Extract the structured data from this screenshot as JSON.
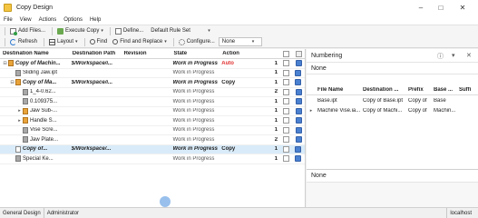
{
  "window": {
    "title": "Copy Design"
  },
  "menu": [
    "File",
    "View",
    "Actions",
    "Options",
    "Help"
  ],
  "toolbar1": {
    "add_files": "Add Files...",
    "execute_copy": "Execute Copy",
    "define": "Define...",
    "rule_set": "Default Rule Set"
  },
  "toolbar2": {
    "refresh": "Refresh",
    "layout": "Layout",
    "find": "Find",
    "find_replace": "Find and Replace",
    "configure": "Configure...",
    "config_value": "None"
  },
  "grid": {
    "headers": [
      "Destination Name",
      "Destination Path",
      "Revision",
      "State",
      "Action"
    ],
    "rows": [
      {
        "expander": "⊟",
        "icon": "asm",
        "name": "Copy of Machin...",
        "path": "$/Workspace/i...",
        "revision": "",
        "state": "Work in Progress",
        "action": "Auto",
        "count": "1",
        "bold": true,
        "italic": true
      },
      {
        "expander": "",
        "icon": "prt",
        "name": "Sliding Jaw.ipt",
        "path": "",
        "revision": "",
        "state": "Work in Progress",
        "action": "",
        "count": "1",
        "bold": false,
        "italic": false
      },
      {
        "expander": "⊟",
        "icon": "asm",
        "name": "Copy of Ma...",
        "path": "$/Workspace/i...",
        "revision": "",
        "state": "Work in Progress",
        "action": "Copy",
        "count": "1",
        "bold": true,
        "italic": true
      },
      {
        "expander": "",
        "icon": "prt",
        "name": "1_4-0.62...",
        "path": "",
        "revision": "",
        "state": "Work in Progress",
        "action": "",
        "count": "2",
        "bold": false,
        "italic": false
      },
      {
        "expander": "",
        "icon": "prt",
        "name": "0.109375...",
        "path": "",
        "revision": "",
        "state": "Work in Progress",
        "action": "",
        "count": "1",
        "bold": false,
        "italic": false
      },
      {
        "expander": "▸",
        "icon": "asm",
        "name": "Jaw Sub-...",
        "path": "",
        "revision": "",
        "state": "Work in Progress",
        "action": "",
        "count": "1",
        "bold": false,
        "italic": false
      },
      {
        "expander": "▸",
        "icon": "asm",
        "name": "Handle S...",
        "path": "",
        "revision": "",
        "state": "Work in Progress",
        "action": "",
        "count": "1",
        "bold": false,
        "italic": false
      },
      {
        "expander": "",
        "icon": "prt",
        "name": "Vise Scre...",
        "path": "",
        "revision": "",
        "state": "Work in Progress",
        "action": "",
        "count": "1",
        "bold": false,
        "italic": false
      },
      {
        "expander": "",
        "icon": "prt",
        "name": "Jaw Plate...",
        "path": "",
        "revision": "",
        "state": "Work in Progress",
        "action": "",
        "count": "2",
        "bold": false,
        "italic": false
      },
      {
        "expander": "",
        "icon": "drw",
        "name": "Copy of...",
        "path": "$/Workspace/...",
        "revision": "",
        "state": "Work in Progress",
        "action": "Copy",
        "count": "1",
        "bold": true,
        "italic": true,
        "selected": true
      },
      {
        "expander": "",
        "icon": "prt",
        "name": "Special Ke...",
        "path": "",
        "revision": "",
        "state": "Work in Progress",
        "action": "",
        "count": "1",
        "bold": false,
        "italic": false
      }
    ]
  },
  "numbering": {
    "title": "Numbering",
    "none_top": "None",
    "headers": [
      "File Name",
      "Destination ...",
      "Prefix",
      "Base ...",
      "Suffi"
    ],
    "rows": [
      {
        "expander": "",
        "file": "Base.ipt",
        "dest": "Copy of Base.ipt",
        "prefix": "Copy of",
        "base": "Base",
        "suffix": ""
      },
      {
        "expander": "▸",
        "file": "Machine Vise.ia...",
        "dest": "Copy of Machi...",
        "prefix": "Copy of",
        "base": "Machin...",
        "suffix": ""
      }
    ],
    "none_bottom": "None"
  },
  "status": {
    "tab1": "General Design",
    "tab2": "Administrator",
    "host": "localhost"
  },
  "colors": {
    "accent": "#4a80d0",
    "action_auto": "#e03030",
    "selected_row": "#d9ebf9"
  }
}
